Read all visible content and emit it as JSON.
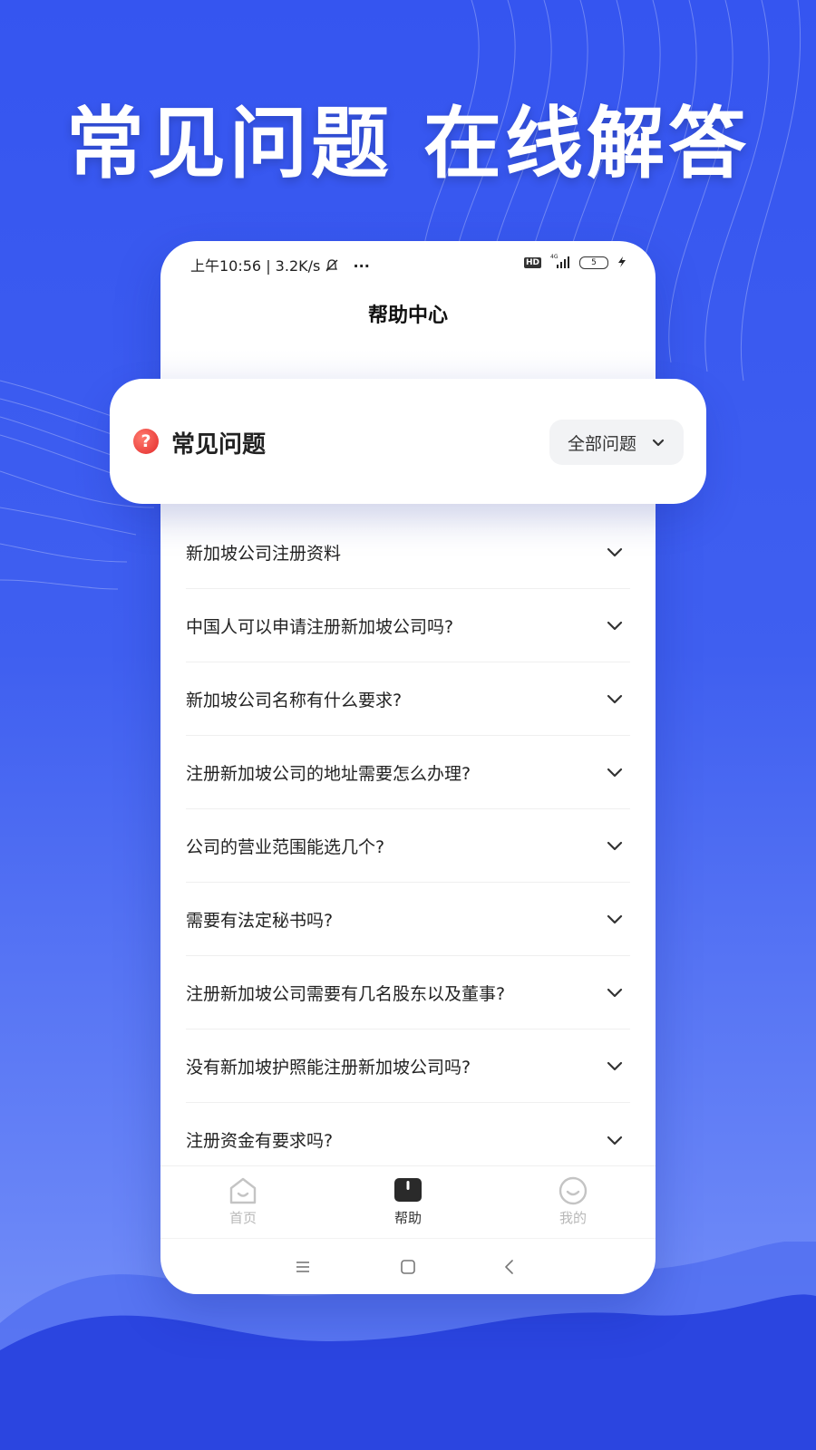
{
  "banner": {
    "headline": "常见问题 在线解答"
  },
  "status_bar": {
    "left": "上午10:56 | 3.2K/s",
    "dots": "···",
    "hd": "HD",
    "network": "4G",
    "battery": "5"
  },
  "header": {
    "title": "帮助中心"
  },
  "faq_card": {
    "title": "常见问题",
    "filter_label": "全部问题",
    "icon_glyph": "?"
  },
  "faq_items": [
    "新加坡公司注册资料",
    "中国人可以申请注册新加坡公司吗?",
    "新加坡公司名称有什么要求?",
    "注册新加坡公司的地址需要怎么办理?",
    "公司的营业范围能选几个?",
    "需要有法定秘书吗?",
    "注册新加坡公司需要有几名股东以及董事?",
    "没有新加坡护照能注册新加坡公司吗?",
    "注册资金有要求吗?"
  ],
  "tabbar": {
    "tabs": [
      {
        "label": "首页",
        "icon": "home-icon",
        "active": false
      },
      {
        "label": "帮助",
        "icon": "book-icon",
        "active": true
      },
      {
        "label": "我的",
        "icon": "smile-face-icon",
        "active": false
      }
    ]
  },
  "nav": {
    "buttons": [
      "menu-icon",
      "home-square-icon",
      "back-icon"
    ]
  },
  "colors": {
    "background": "#3555f0",
    "accent_red": "#e32b2b",
    "text_dark": "#222222"
  }
}
